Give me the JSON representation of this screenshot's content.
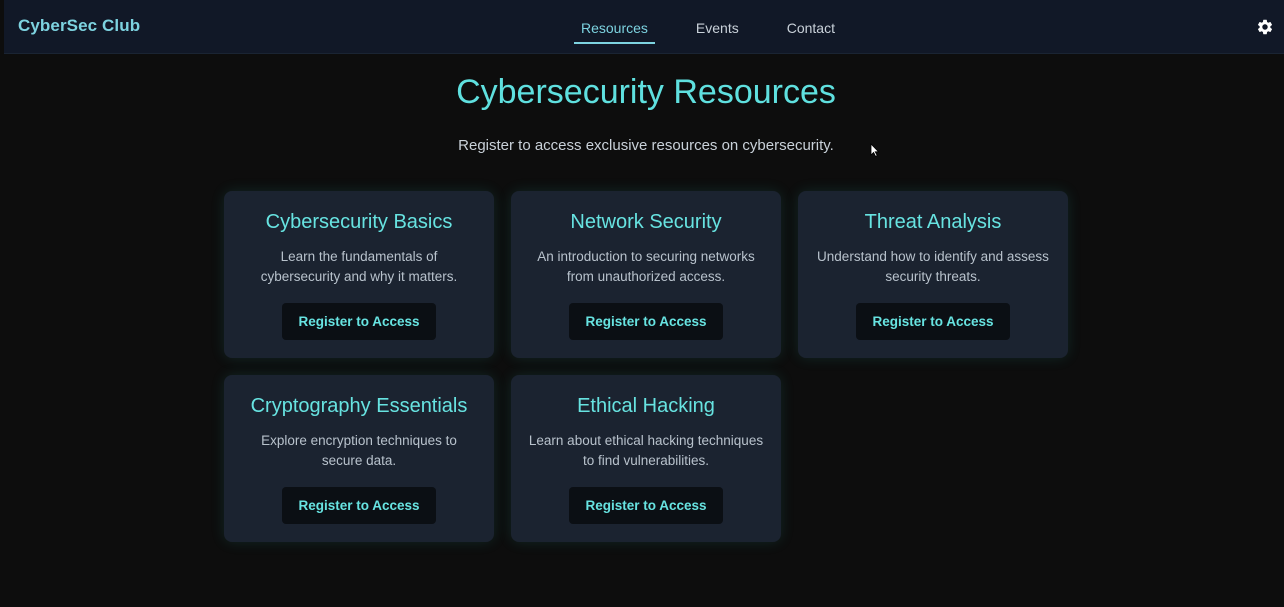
{
  "nav": {
    "brand": "CyberSec Club",
    "links": [
      {
        "label": "Resources",
        "active": true
      },
      {
        "label": "Events",
        "active": false
      },
      {
        "label": "Contact",
        "active": false
      }
    ],
    "settings_icon": "gear-icon"
  },
  "main": {
    "title": "Cybersecurity Resources",
    "subtitle": "Register to access exclusive resources on cybersecurity."
  },
  "cards": [
    {
      "title": "Cybersecurity Basics",
      "description": "Learn the fundamentals of cybersecurity and why it matters.",
      "button": "Register to Access"
    },
    {
      "title": "Network Security",
      "description": "An introduction to securing networks from unauthorized access.",
      "button": "Register to Access"
    },
    {
      "title": "Threat Analysis",
      "description": "Understand how to identify and assess security threats.",
      "button": "Register to Access"
    },
    {
      "title": "Cryptography Essentials",
      "description": "Explore encryption techniques to secure data.",
      "button": "Register to Access"
    },
    {
      "title": "Ethical Hacking",
      "description": "Learn about ethical hacking techniques to find vulnerabilities.",
      "button": "Register to Access"
    }
  ],
  "colors": {
    "accent": "#5fe0df",
    "background": "#0d0d0d",
    "navbar": "#111827",
    "card": "#1b2330"
  }
}
